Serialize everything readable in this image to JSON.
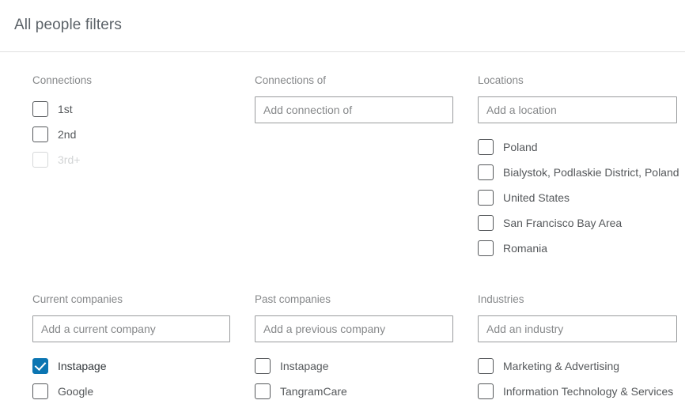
{
  "header": {
    "title": "All people filters"
  },
  "accent_color": "#0b75b2",
  "groups": [
    {
      "key": "connections",
      "title": "Connections",
      "has_input": false,
      "options": [
        {
          "label": "1st",
          "checked": false,
          "disabled": false
        },
        {
          "label": "2nd",
          "checked": false,
          "disabled": false
        },
        {
          "label": "3rd+",
          "checked": false,
          "disabled": true
        }
      ]
    },
    {
      "key": "connections_of",
      "title": "Connections of",
      "has_input": true,
      "input": {
        "value": "",
        "placeholder": "Add connection of"
      },
      "options": []
    },
    {
      "key": "locations",
      "title": "Locations",
      "has_input": true,
      "input": {
        "value": "",
        "placeholder": "Add a location"
      },
      "options": [
        {
          "label": "Poland",
          "checked": false,
          "disabled": false
        },
        {
          "label": "Bialystok, Podlaskie District, Poland",
          "checked": false,
          "disabled": false
        },
        {
          "label": "United States",
          "checked": false,
          "disabled": false
        },
        {
          "label": "San Francisco Bay Area",
          "checked": false,
          "disabled": false
        },
        {
          "label": "Romania",
          "checked": false,
          "disabled": false
        }
      ]
    },
    {
      "key": "current_companies",
      "title": "Current companies",
      "has_input": true,
      "input": {
        "value": "",
        "placeholder": "Add a current company"
      },
      "options": [
        {
          "label": "Instapage",
          "checked": true,
          "disabled": false
        },
        {
          "label": "Google",
          "checked": false,
          "disabled": false
        }
      ]
    },
    {
      "key": "past_companies",
      "title": "Past companies",
      "has_input": true,
      "input": {
        "value": "",
        "placeholder": "Add a previous company"
      },
      "options": [
        {
          "label": "Instapage",
          "checked": false,
          "disabled": false
        },
        {
          "label": "TangramCare",
          "checked": false,
          "disabled": false
        }
      ]
    },
    {
      "key": "industries",
      "title": "Industries",
      "has_input": true,
      "input": {
        "value": "",
        "placeholder": "Add an industry"
      },
      "options": [
        {
          "label": "Marketing & Advertising",
          "checked": false,
          "disabled": false
        },
        {
          "label": "Information Technology & Services",
          "checked": false,
          "disabled": false
        }
      ]
    }
  ]
}
